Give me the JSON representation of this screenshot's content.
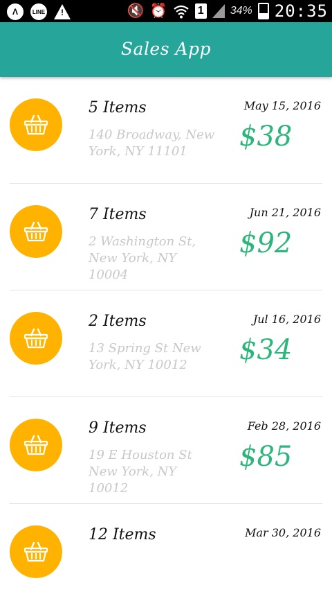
{
  "status_bar": {
    "notifications": [
      "a-logo-icon",
      "line-app-icon",
      "warning-icon"
    ],
    "battery_percent": "34%",
    "time": "20:35",
    "sim_label": "1"
  },
  "toolbar": {
    "title": "Sales App",
    "color": "#26a69a"
  },
  "colors": {
    "avatar": "#ffb300",
    "amount": "#2db67c",
    "address": "#c8c8c8"
  },
  "orders": [
    {
      "items": "5 Items",
      "address": "140 Broadway, New York, NY 11101",
      "date": "May 15, 2016",
      "amount": "$38",
      "icon": "basket-icon"
    },
    {
      "items": "7 Items",
      "address": "2 Washington St, New York, NY 10004",
      "date": "Jun 21, 2016",
      "amount": "$92",
      "icon": "basket-icon"
    },
    {
      "items": "2 Items",
      "address": "13 Spring St New York, NY 10012",
      "date": "Jul 16, 2016",
      "amount": "$34",
      "icon": "basket-icon"
    },
    {
      "items": "9 Items",
      "address": "19 E Houston St New York, NY 10012",
      "date": "Feb 28, 2016",
      "amount": "$85",
      "icon": "basket-icon"
    },
    {
      "items": "12 Items",
      "address": "",
      "date": "Mar 30, 2016",
      "amount": "",
      "icon": "basket-icon"
    }
  ]
}
